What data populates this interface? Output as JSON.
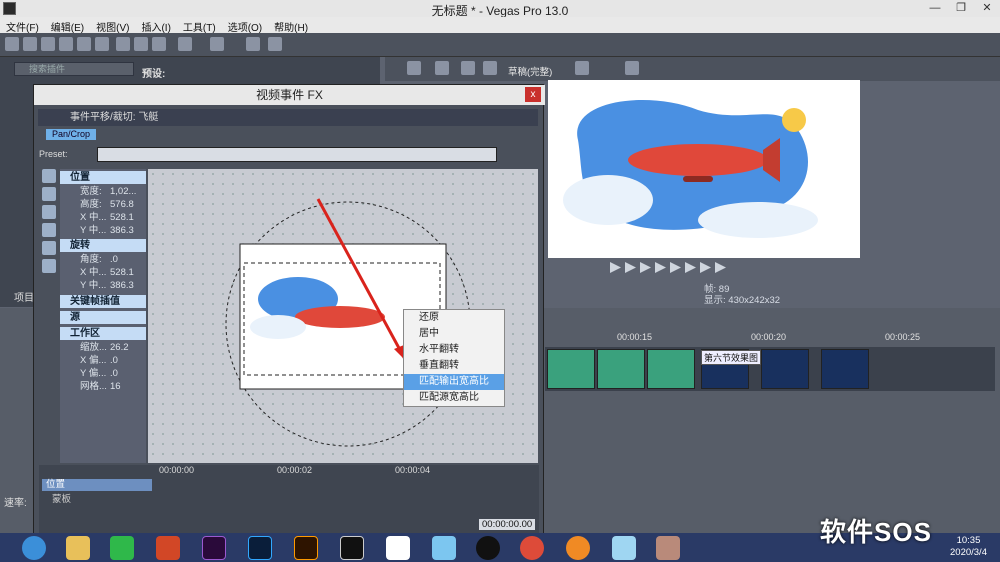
{
  "window": {
    "title": "无标题 * - Vegas Pro 13.0"
  },
  "menu": [
    "文件(F)",
    "编辑(E)",
    "视图(V)",
    "插入(I)",
    "工具(T)",
    "选项(O)",
    "帮助(H)"
  ],
  "left_panel": {
    "search_placeholder": "搜索插件",
    "preset_label": "预设:",
    "project_tab": "项目"
  },
  "preview": {
    "quality": "草稿(完整)",
    "frame_label": "帧:",
    "frame_value": "89",
    "display_label": "显示:",
    "display_value": "430x242x32"
  },
  "timeline": {
    "ruler": [
      "00:00:15",
      "00:00:20",
      "00:00:25"
    ],
    "clip_label": "第六节效果图",
    "rate_label": "速率:"
  },
  "dialog": {
    "title": "视频事件 FX",
    "close": "x",
    "chain": "事件平移/裁切: 飞艇",
    "tab": "Pan/Crop",
    "preset_label": "Preset:",
    "sections": [
      {
        "name": "位置",
        "rows": [
          [
            "宽度:",
            "1,02..."
          ],
          [
            "高度:",
            "576.8"
          ],
          [
            "X 中...",
            "528.1"
          ],
          [
            "Y 中...",
            "386.3"
          ]
        ]
      },
      {
        "name": "旋转",
        "rows": [
          [
            "角度:",
            ".0"
          ],
          [
            "X 中...",
            "528.1"
          ],
          [
            "Y 中...",
            "386.3"
          ]
        ]
      },
      {
        "name": "关键帧插值",
        "rows": []
      },
      {
        "name": "源",
        "rows": []
      },
      {
        "name": "工作区",
        "rows": [
          [
            "缩放...",
            "26.2"
          ],
          [
            "X 偏...",
            ".0"
          ],
          [
            "Y 偏...",
            ".0"
          ],
          [
            "网格...",
            "16"
          ]
        ]
      }
    ],
    "kf_ruler": [
      "00:00:00",
      "00:00:02",
      "00:00:04"
    ],
    "kf_position": "位置",
    "kf_mask": "蒙板",
    "kf_time": "00:00:00.00"
  },
  "context_menu": [
    "还原",
    "居中",
    "水平翻转",
    "垂直翻转",
    "匹配输出宽高比",
    "匹配源宽高比"
  ],
  "taskbar": {
    "time": "10:35",
    "date": "2020/3/4"
  },
  "watermark": "软件SOS"
}
